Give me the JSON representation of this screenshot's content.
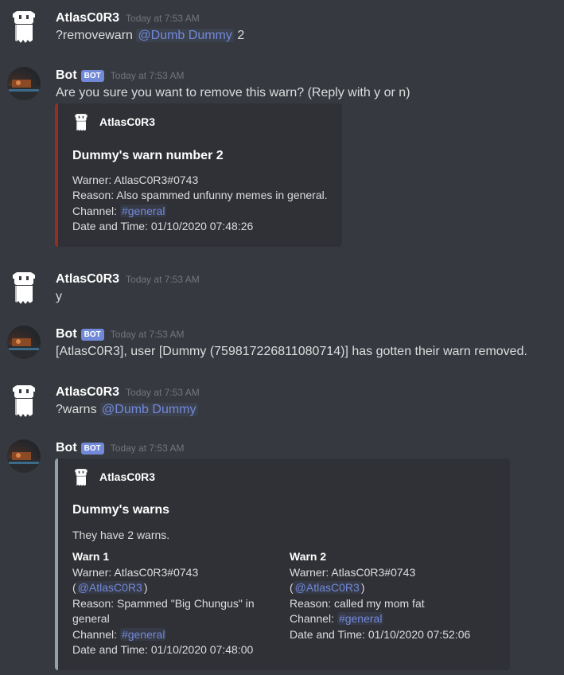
{
  "colors": {
    "background": "#36393f",
    "embed_bg": "#2f3136",
    "accent": "#7289da",
    "embed_red": "#992d22",
    "embed_grey": "#95a5a6"
  },
  "messages": [
    {
      "author": "AtlasC0R3",
      "timestamp": "Today at 7:53 AM",
      "command": "?removewarn",
      "mention": "@Dumb Dummy",
      "arg": "2"
    },
    {
      "author": "Bot",
      "bot_tag": "BOT",
      "timestamp": "Today at 7:53 AM",
      "text": "Are you sure you want to remove this warn? (Reply with y or n)",
      "embed": {
        "author": "AtlasC0R3",
        "title": "Dummy's warn number 2",
        "warner": "Warner: AtlasC0R3#0743",
        "reason": "Reason: Also spammed unfunny memes in general.",
        "channel_label": "Channel:",
        "channel": "#general",
        "datetime": "Date and Time: 01/10/2020 07:48:26"
      }
    },
    {
      "author": "AtlasC0R3",
      "timestamp": "Today at 7:53 AM",
      "text": "y"
    },
    {
      "author": "Bot",
      "bot_tag": "BOT",
      "timestamp": "Today at 7:53 AM",
      "text": "[AtlasC0R3], user [Dummy (759817226811080714)] has gotten their warn removed."
    },
    {
      "author": "AtlasC0R3",
      "timestamp": "Today at 7:53 AM",
      "command": "?warns",
      "mention": "@Dumb Dummy"
    },
    {
      "author": "Bot",
      "bot_tag": "BOT",
      "timestamp": "Today at 7:53 AM",
      "embed": {
        "author": "AtlasC0R3",
        "title": "Dummy's warns",
        "description": "They have 2 warns.",
        "fields": [
          {
            "name": "Warn 1",
            "warner": "Warner: AtlasC0R3#0743",
            "open": "(",
            "mention": "@AtlasC0R3",
            "close": ")",
            "reason_1": "Reason: Spammed \"Big Chungus\" in",
            "reason_2": "general",
            "channel_label": "Channel:",
            "channel": "#general",
            "datetime": "Date and Time: 01/10/2020 07:48:00"
          },
          {
            "name": "Warn 2",
            "warner": "Warner: AtlasC0R3#0743",
            "open": "(",
            "mention": "@AtlasC0R3",
            "close": ")",
            "reason_1": "Reason: called my mom fat",
            "channel_label": "Channel:",
            "channel": "#general",
            "datetime": "Date and Time: 01/10/2020 07:52:06"
          }
        ]
      }
    }
  ]
}
